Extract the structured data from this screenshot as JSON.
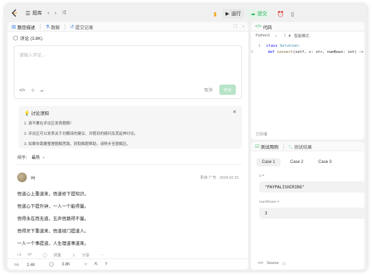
{
  "topbar": {
    "problem_list_label": "题库",
    "run_label": "运行",
    "submit_label": "提交"
  },
  "left_tabs": [
    {
      "label": "题目描述",
      "icon": "doc-icon",
      "active": true
    },
    {
      "label": "题解",
      "icon": "flask-icon",
      "active": false
    },
    {
      "label": "提交记录",
      "icon": "history-icon",
      "active": false
    }
  ],
  "comments": {
    "header": "评论 (3.8K)",
    "placeholder": "请输入评论...",
    "tools": [
      "</>",
      "☺",
      "↵"
    ],
    "cancel_label": "取消",
    "submit_label": "评论"
  },
  "notice": {
    "title": "讨论须知",
    "lines": [
      "1. 请不要在评论区发表题解！",
      "2. 评论区可以发表关于对翻译的建议、对题目的疑问及其延伸讨论。",
      "3. 如果你需要整理题解思路，获取解题帮助，请移步至题解区。"
    ]
  },
  "sort": {
    "label": "排序：",
    "value": "最热"
  },
  "post": {
    "author": "叶",
    "meta": "来自 广东 · 2024.02.15",
    "lines": [
      "悟道心上重道来，悟道修下提知识。",
      "悟道心下提升钟，一人一个能得量。",
      "悟得永在而无道，五声悟路得不量。",
      "悟得灵下重道来，悟道视门提道人。",
      "一人一个事提道，人生理道事道来。"
    ],
    "likes": "47",
    "reply_label": "回复",
    "share_label": "分享"
  },
  "bottom_bar": {
    "likes": "2.4K",
    "comments": "3.8K"
  },
  "code_panel": {
    "title": "代码",
    "language": "Python3",
    "mode": "智能模式",
    "lines": [
      {
        "num": "1",
        "tokens": [
          {
            "t": "class ",
            "c": "kw"
          },
          {
            "t": "Solution:",
            "c": "cls"
          }
        ]
      },
      {
        "num": "2",
        "tokens": [
          {
            "t": "    def ",
            "c": "kw"
          },
          {
            "t": "convert",
            "c": "fn"
          },
          {
            "t": "(self, s: str, numRows: int) -> str:",
            "c": ""
          }
        ]
      }
    ],
    "footer": "已存储"
  },
  "test_panel": {
    "tab_cases": "测试用例",
    "tab_results": "测试结果",
    "cases": [
      "Case 1",
      "Case 2",
      "Case 3"
    ],
    "field1_label": "s =",
    "field1_value": "\"PAYPALISHIRING\"",
    "field2_label": "numRows =",
    "field2_value": "3",
    "footer": "Source"
  },
  "colors": {
    "accent_green": "#2db55d",
    "submit_disabled": "#b7e4c7",
    "notice_bulb": "#f5b800"
  }
}
